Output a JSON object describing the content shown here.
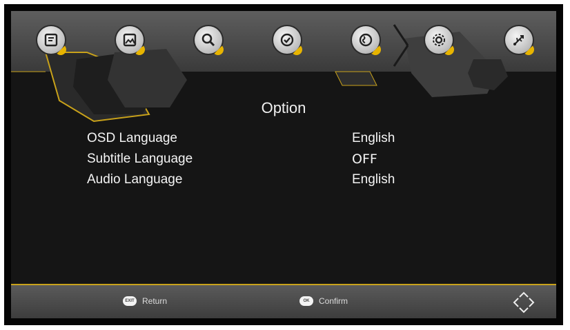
{
  "menu": {
    "icons": [
      {
        "name": "program-icon"
      },
      {
        "name": "picture-icon"
      },
      {
        "name": "search-icon"
      },
      {
        "name": "time-icon"
      },
      {
        "name": "globe-icon"
      },
      {
        "name": "settings-gear-icon"
      },
      {
        "name": "usb-icon"
      }
    ]
  },
  "page": {
    "title": "Option"
  },
  "options": [
    {
      "label": "OSD Language",
      "value": "English"
    },
    {
      "label": "Subtitle Language",
      "value": "OFF"
    },
    {
      "label": "Audio Language",
      "value": "English"
    }
  ],
  "footer": {
    "return_key": "EXIT",
    "return_label": "Return",
    "confirm_key": "OK",
    "confirm_label": "Confirm"
  },
  "colors": {
    "accent": "#e7b400",
    "background": "#151515",
    "text": "#f4f4f4"
  }
}
